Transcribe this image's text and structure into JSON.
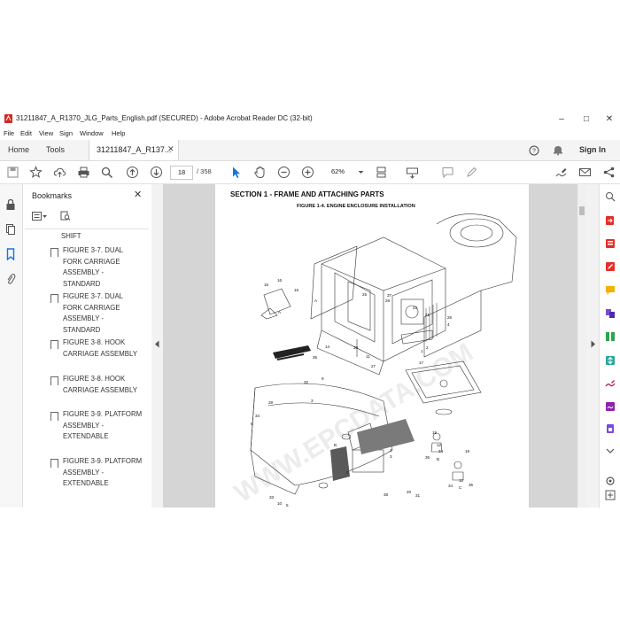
{
  "window": {
    "title": "31211847_A_R1370_JLG_Parts_English.pdf (SECURED) - Adobe Acrobat Reader DC (32-bit)",
    "min_glyph": "–",
    "max_glyph": "□",
    "close_glyph": "✕"
  },
  "menu": [
    "File",
    "Edit",
    "View",
    "Sign",
    "Window",
    "Help"
  ],
  "tabs": {
    "home": "Home",
    "tools": "Tools",
    "document": "31211847_A_R137...",
    "sign_in": "Sign In"
  },
  "toolbar": {
    "page_current": "18",
    "page_total": "/ 358",
    "zoom": "62%"
  },
  "bookmarks": {
    "title": "Bookmarks",
    "partial_top": "SHIFT",
    "items": [
      "FIGURE 3-7. DUAL FORK CARRIAGE ASSEMBLY - STANDARD",
      "FIGURE 3-7. DUAL FORK CARRIAGE ASSEMBLY - STANDARD",
      "FIGURE 3-8. HOOK CARRIAGE ASSEMBLY",
      "FIGURE 3-8. HOOK CARRIAGE ASSEMBLY",
      "FIGURE 3-9. PLATFORM ASSEMBLY - EXTENDABLE",
      "FIGURE 3-9. PLATFORM ASSEMBLY - EXTENDABLE"
    ]
  },
  "document": {
    "section_heading": "SECTION 1 - FRAME AND ATTACHING PARTS",
    "figure_title": "FIGURE 1-4. ENGINE ENCLOSURE INSTALLATION",
    "watermark": "WWW.EPCDATA.COM"
  },
  "colors": {
    "accent_blue": "#1473e6",
    "viewer_bg": "#d5d5d5",
    "acrobat_red": "#d7261e"
  }
}
